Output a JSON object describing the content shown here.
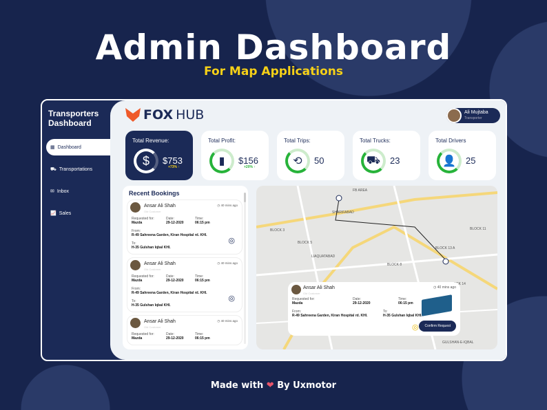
{
  "header": {
    "title": "Admin Dashboard",
    "subtitle": "For Map Applications"
  },
  "sidebar": {
    "title": "Transporters Dashboard",
    "items": [
      {
        "label": "Dashboard",
        "icon": "dashboard-icon"
      },
      {
        "label": "Transportations",
        "icon": "truck-icon"
      },
      {
        "label": "Inbox",
        "icon": "mail-icon"
      },
      {
        "label": "Sales",
        "icon": "chart-icon"
      }
    ]
  },
  "brand": {
    "fox": "FOX",
    "hub": "HUB"
  },
  "user": {
    "name": "Ali Mujtaba",
    "role": "Transporter"
  },
  "stats": [
    {
      "label": "Total Revenue:",
      "value": "$753",
      "change": "+73% ↑",
      "icon": "$"
    },
    {
      "label": "Total Profit:",
      "value": "$156",
      "change": "+20% ↑",
      "icon": "📶"
    },
    {
      "label": "Total Trips:",
      "value": "50",
      "icon": "⟲"
    },
    {
      "label": "Total Trucks:",
      "value": "23",
      "icon": "🚚"
    },
    {
      "label": "Total Drivers",
      "value": "25",
      "icon": "👥"
    }
  ],
  "bookings": {
    "title": "Recent Bookings",
    "items": [
      {
        "name": "Ansar Ali Shah",
        "tag": "Old Customer",
        "ago": "40 mins ago",
        "req_label": "Requested for:",
        "req": "Mazda",
        "date_label": "Date:",
        "date": "29-12-2020",
        "time_label": "Time:",
        "time": "06:15 pm",
        "from_label": "From:",
        "from": "R-49 Sahreena Garden, Kiran Hospital rd. KHI.",
        "to_label": "To:",
        "to": "H-35 Gulshan Iqbal KHI."
      },
      {
        "name": "Ansar Ali Shah",
        "tag": "Old Customer",
        "ago": "40 mins ago",
        "req_label": "Requested for:",
        "req": "Mazda",
        "date_label": "Date:",
        "date": "29-12-2020",
        "time_label": "Time:",
        "time": "06:15 pm",
        "from_label": "From:",
        "from": "R-49 Sahreena Garden, Kiran Hospital rd. KHI.",
        "to_label": "To:",
        "to": "H-35 Gulshan Iqbal KHI."
      },
      {
        "name": "Ansar Ali Shah",
        "tag": "Old Customer",
        "ago": "40 mins ago",
        "req_label": "Requested for:",
        "req": "Mazda",
        "date_label": "Date:",
        "date": "29-12-2020",
        "time_label": "Time:",
        "time": "06:15 pm"
      }
    ]
  },
  "map": {
    "labels": [
      "BLOCK 5",
      "BLOCK 3",
      "BLOCK 13 A",
      "BLOCK 14",
      "LIAQUATABAD",
      "GULSHAN-E-IQBAL",
      "SHARIFABAD",
      "FB AREA",
      "BLOCK 8",
      "BLOCK 11"
    ],
    "popup": {
      "name": "Ansar Ali Shah",
      "tag": "Old Customer",
      "ago": "40 mins ago",
      "req_label": "Requested for:",
      "req": "Mazda",
      "date_label": "Date:",
      "date": "29-12-2020",
      "time_label": "Time:",
      "time": "06:15 pm",
      "from_label": "From:",
      "from": "R-49 Sahreena Garden, Kiran Hospital rd. KHI.",
      "to_label": "To:",
      "to": "H-35 Gulshan Iqbal KHI.",
      "button": "Confirm Request"
    }
  },
  "footer": {
    "made": "Made with",
    "heart": "❤",
    "by": "By Uxmotor"
  }
}
